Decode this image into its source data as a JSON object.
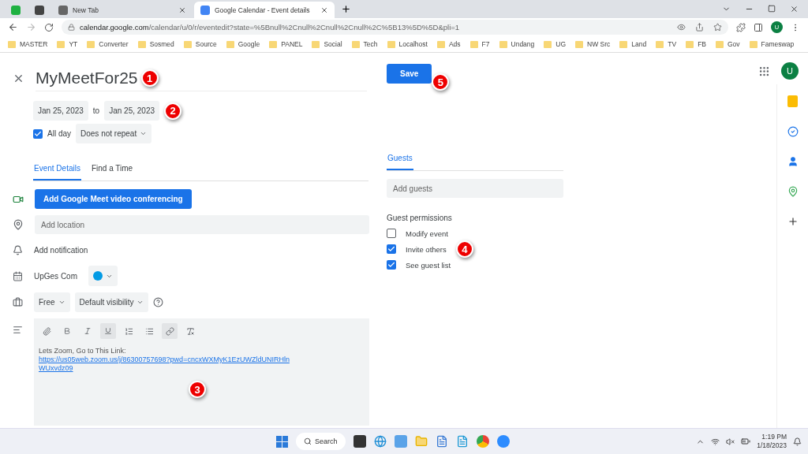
{
  "browser": {
    "tabs": [
      {
        "kind": "pinned",
        "selected": false
      },
      {
        "kind": "pinned",
        "selected": false
      },
      {
        "kind": "page",
        "title": "New Tab",
        "selected": false
      },
      {
        "kind": "page",
        "title": "Google Calendar - Event details",
        "selected": true
      }
    ],
    "url_host": "calendar.google.com",
    "url_path": "/calendar/u/0/r/eventedit?state=%5Bnull%2Cnull%2Cnull%2Cnull%2C%5B13%5D%5D&pli=1",
    "profile": "U",
    "bookmarks": [
      "MASTER",
      "YT",
      "Converter",
      "Sosmed",
      "Source",
      "Google",
      "PANEL",
      "Social",
      "Tech",
      "Localhost",
      "Ads",
      "F7",
      "Undang",
      "UG",
      "NW Src",
      "Land",
      "TV",
      "FB",
      "Gov",
      "Fameswap"
    ]
  },
  "event": {
    "title": "MyMeetFor25",
    "start_date": "Jan 25, 2023",
    "to": "to",
    "end_date": "Jan 25, 2023",
    "all_day": {
      "label": "All day",
      "checked": true
    },
    "repeat": "Does not repeat",
    "tabs": [
      {
        "label": "Event Details",
        "selected": true
      },
      {
        "label": "Find a Time",
        "selected": false
      }
    ],
    "meet_button": "Add Google Meet video conferencing",
    "location": {
      "placeholder": "Add location"
    },
    "notification": "Add notification",
    "calendar": {
      "name": "UpGes Com",
      "color": "#039be5"
    },
    "availability": "Free",
    "visibility": "Default visibility",
    "description": {
      "text": "Lets Zoom, Go to This Link: ",
      "link": "https://us05web.zoom.us/j/86300757698?pwd=cncxWXMyK1EzUWZldUNIRHlnWUxvdz09"
    }
  },
  "save": "Save",
  "avatar": "U",
  "guests": {
    "tabs": [
      {
        "label": "Guests",
        "selected": true
      }
    ],
    "input": {
      "placeholder": "Add guests"
    },
    "permissions_title": "Guest permissions",
    "permissions": [
      {
        "label": "Modify event",
        "checked": false
      },
      {
        "label": "Invite others",
        "checked": true
      },
      {
        "label": "See guest list",
        "checked": true
      }
    ]
  },
  "callouts": [
    "1",
    "2",
    "3",
    "4",
    "5"
  ],
  "taskbar": {
    "search": "Search",
    "time": "1:19 PM",
    "date": "1/18/2023"
  }
}
